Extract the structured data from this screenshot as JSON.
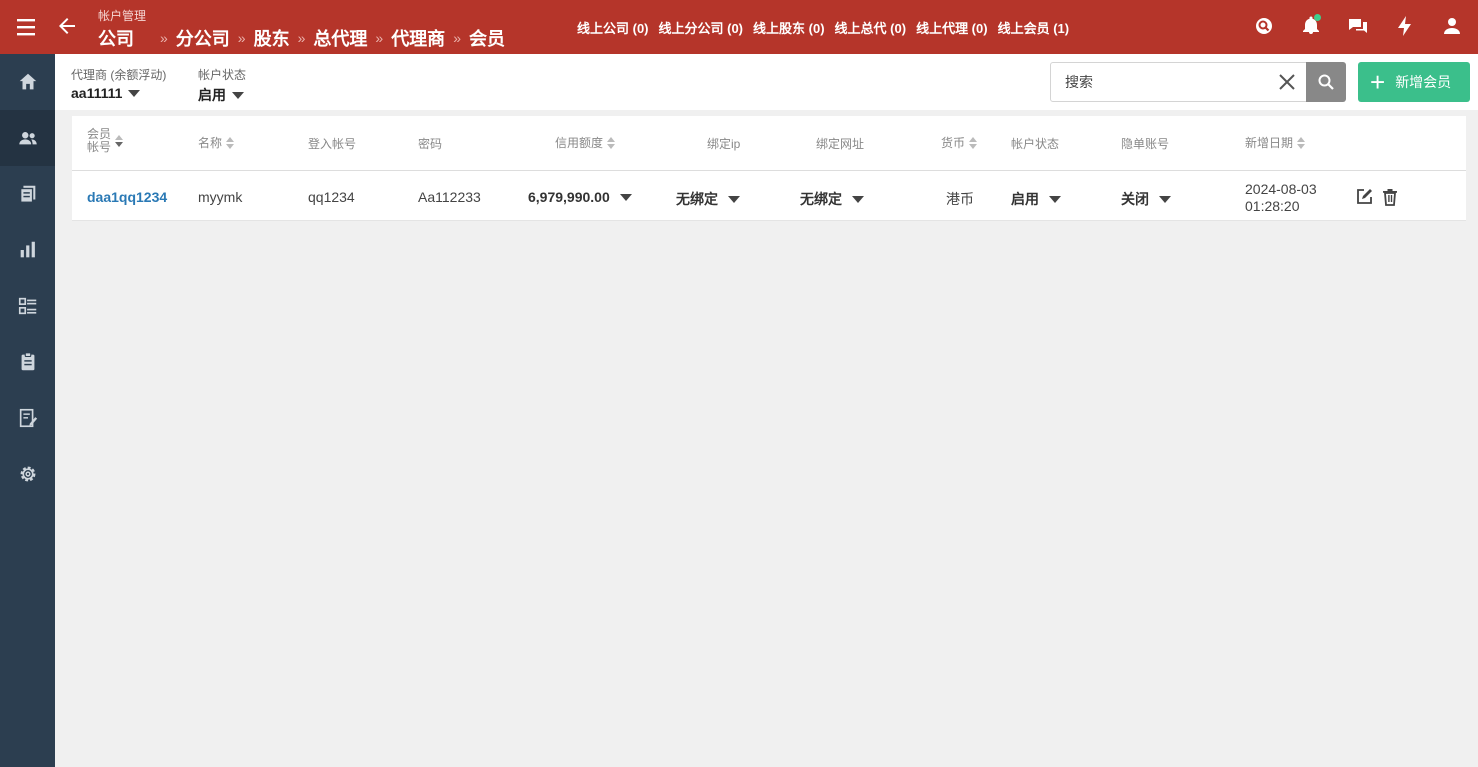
{
  "header": {
    "section_title": "帐户管理",
    "breadcrumbs": [
      "公司",
      "分公司",
      "股东",
      "总代理",
      "代理商",
      "会员"
    ],
    "separator": "»",
    "online_stats": [
      "线上公司 (0)",
      "线上分公司 (0)",
      "线上股东 (0)",
      "线上总代 (0)",
      "线上代理 (0)",
      "线上会员 (1)"
    ],
    "icons": [
      "search-icon",
      "bell-icon",
      "chat-icon",
      "bolt-icon",
      "user-icon"
    ]
  },
  "sidebar": {
    "items": [
      {
        "name": "home",
        "icon": "home-icon"
      },
      {
        "name": "members",
        "icon": "users-icon",
        "active": true
      },
      {
        "name": "reports",
        "icon": "documents-icon"
      },
      {
        "name": "statistics",
        "icon": "bar-chart-icon"
      },
      {
        "name": "list",
        "icon": "list-icon"
      },
      {
        "name": "clipboard",
        "icon": "clipboard-icon"
      },
      {
        "name": "notes",
        "icon": "edit-note-icon"
      },
      {
        "name": "settings",
        "icon": "gear-icon"
      }
    ]
  },
  "filters": {
    "agent_label": "代理商 (余额浮动)",
    "agent_value": "aa11111",
    "status_label": "帐户状态",
    "status_value": "启用",
    "search_placeholder": "搜索",
    "add_button": "新增会员"
  },
  "table": {
    "headers": {
      "member_account_line1": "会员",
      "member_account_line2": "帐号",
      "name": "名称",
      "login": "登入帐号",
      "password": "密码",
      "credit": "信用额度",
      "bind_ip": "绑定ip",
      "bind_url": "绑定网址",
      "currency": "货币",
      "status": "帐户状态",
      "hidden": "隐单账号",
      "created": "新增日期"
    },
    "rows": [
      {
        "member_account": "daa1qq1234",
        "name": "myymk",
        "login": "qq1234",
        "password": "Aa112233",
        "credit": "6,979,990.00",
        "bind_ip": "无绑定",
        "bind_url": "无绑定",
        "currency": "港币",
        "status": "启用",
        "hidden": "关闭",
        "created_date": "2024-08-03",
        "created_time": "01:28:20"
      }
    ]
  },
  "colors": {
    "header_bg": "#b5352a",
    "sidebar_bg": "#2c3e50",
    "add_button_bg": "#3bbf8b",
    "link": "#2a79b5"
  }
}
